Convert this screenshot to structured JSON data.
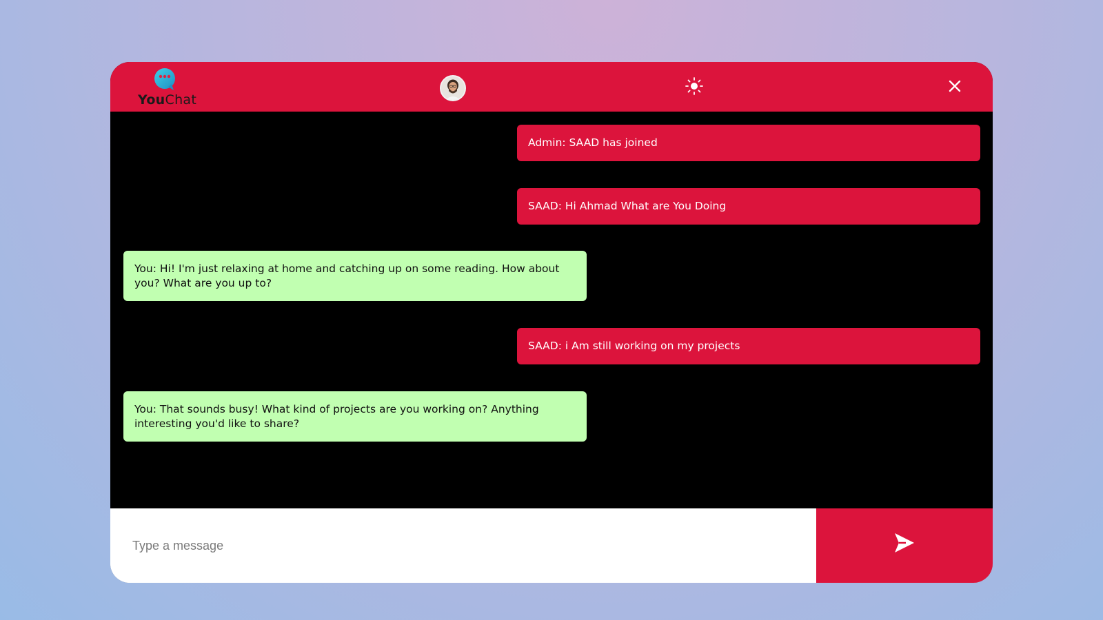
{
  "app": {
    "logo_bold": "You",
    "logo_light": "Chat"
  },
  "header": {
    "avatar_icon": "user-avatar",
    "theme_icon": "sun-icon",
    "close_icon": "close-icon",
    "accent_color": "#dc143c"
  },
  "messages": [
    {
      "sender": "other",
      "text": "Admin: SAAD has joined"
    },
    {
      "sender": "other",
      "text": "SAAD: Hi Ahmad What are You Doing"
    },
    {
      "sender": "self",
      "text": "You: Hi! I'm just relaxing at home and catching up on some reading. How about you? What are you up to?"
    },
    {
      "sender": "other",
      "text": "SAAD: i Am still working on my projects"
    },
    {
      "sender": "self",
      "text": "You: That sounds busy! What kind of projects are you working on? Anything interesting you'd like to share?"
    }
  ],
  "composer": {
    "placeholder": "Type a message",
    "value": "",
    "send_icon": "send-icon"
  },
  "colors": {
    "incoming_bubble": "#dc143c",
    "outgoing_bubble": "#c1ffb1",
    "chat_background": "#000000"
  }
}
